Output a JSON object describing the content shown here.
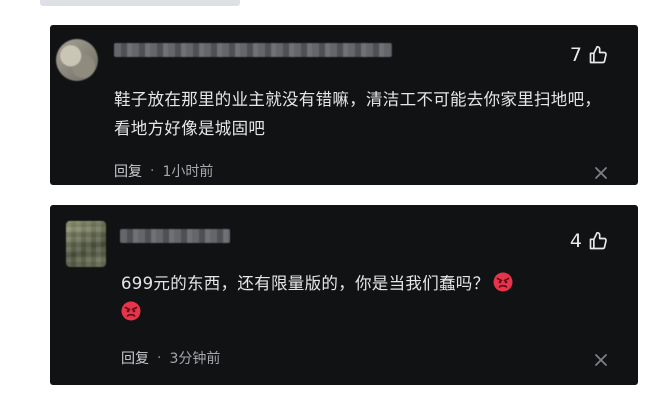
{
  "comments": [
    {
      "like_count": "7",
      "text": "鞋子放在那里的业主就没有错嘛，清洁工不可能去你家里扫地吧，看地方好像是城固吧",
      "reply_label": "回复",
      "separator": "·",
      "time": "1小时前",
      "icons": {
        "like": "thumbs-up-icon",
        "close": "close-icon"
      }
    },
    {
      "like_count": "4",
      "text": "699元的东西，还有限量版的，你是当我们蠢吗？",
      "reply_label": "回复",
      "separator": "·",
      "time": "3分钟前",
      "emojis": [
        "angry-face-emoji",
        "angry-face-emoji"
      ],
      "icons": {
        "like": "thumbs-up-icon",
        "close": "close-icon"
      }
    }
  ],
  "colors": {
    "card_background": "#111214",
    "text_primary": "#e6e6e8",
    "text_secondary": "#a5a7ad",
    "emoji_red": "#e8344a"
  }
}
